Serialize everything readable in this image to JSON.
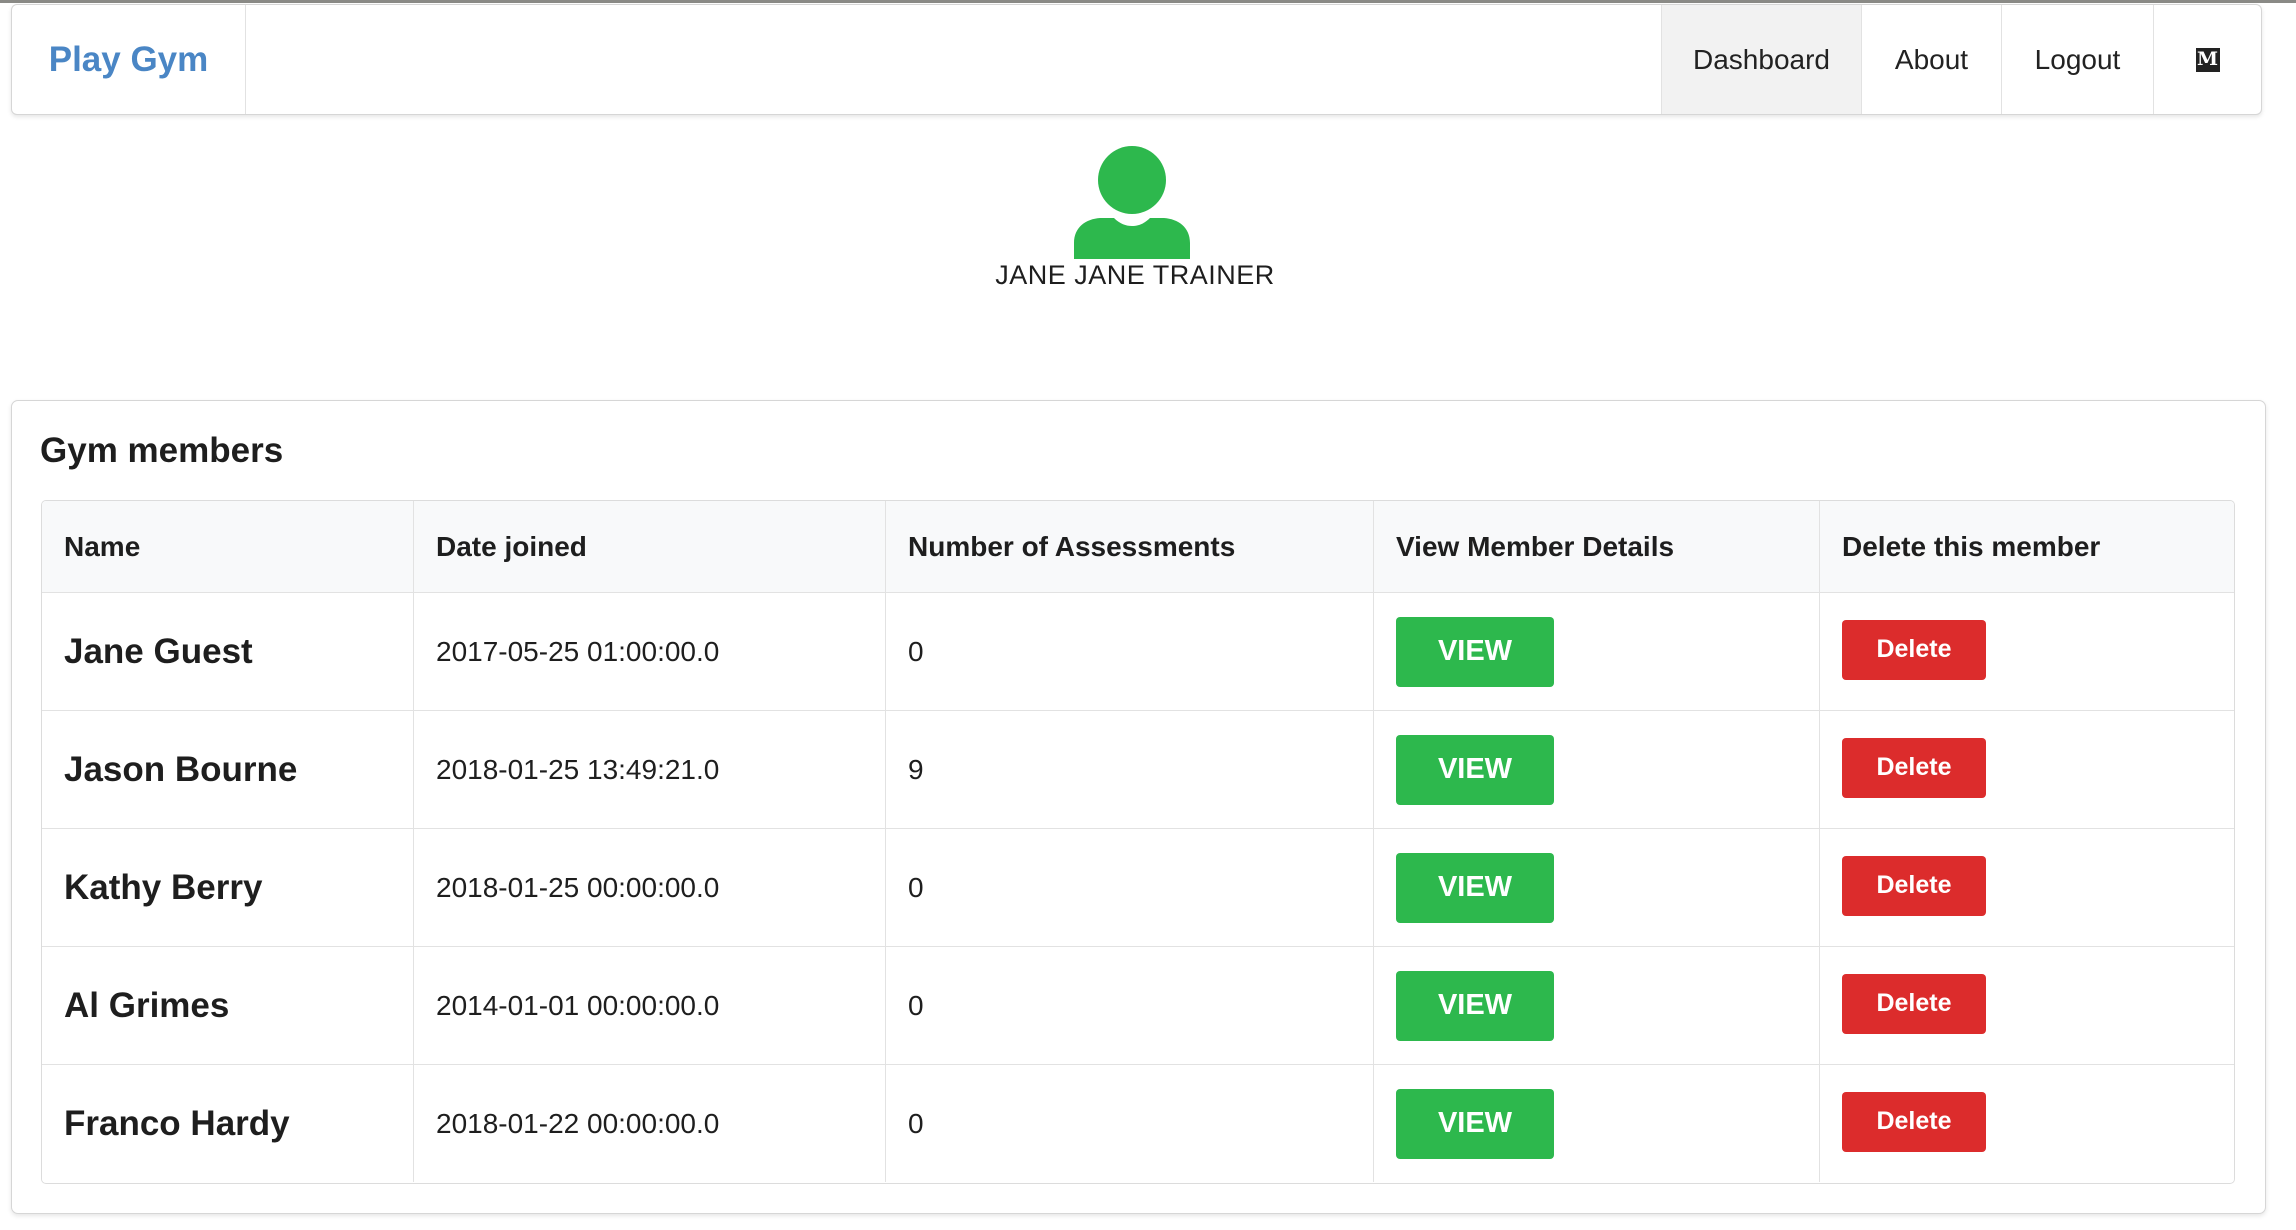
{
  "navbar": {
    "brand": "Play Gym",
    "items": [
      {
        "label": "Dashboard",
        "active": true
      },
      {
        "label": "About"
      },
      {
        "label": "Logout"
      }
    ],
    "medium_icon_glyph": "M"
  },
  "profile": {
    "name": "JANE JANE TRAINER",
    "icon": "user-icon",
    "icon_color": "#2db84d"
  },
  "members": {
    "title": "Gym members",
    "columns": [
      "Name",
      "Date joined",
      "Number of Assessments",
      "View Member Details",
      "Delete this member"
    ],
    "rows": [
      {
        "name": "Jane Guest",
        "date_joined": "2017-05-25 01:00:00.0",
        "assessments": "0",
        "view_label": "VIEW",
        "delete_label": "Delete"
      },
      {
        "name": "Jason Bourne",
        "date_joined": "2018-01-25 13:49:21.0",
        "assessments": "9",
        "view_label": "VIEW",
        "delete_label": "Delete"
      },
      {
        "name": "Kathy Berry",
        "date_joined": "2018-01-25 00:00:00.0",
        "assessments": "0",
        "view_label": "VIEW",
        "delete_label": "Delete"
      },
      {
        "name": "Al Grimes",
        "date_joined": "2014-01-01 00:00:00.0",
        "assessments": "0",
        "view_label": "VIEW",
        "delete_label": "Delete"
      },
      {
        "name": "Franco Hardy",
        "date_joined": "2018-01-22 00:00:00.0",
        "assessments": "0",
        "view_label": "VIEW",
        "delete_label": "Delete"
      }
    ]
  },
  "colors": {
    "brand": "#4a86c5",
    "view_button": "#2db84d",
    "delete_button": "#dc2c2c"
  }
}
